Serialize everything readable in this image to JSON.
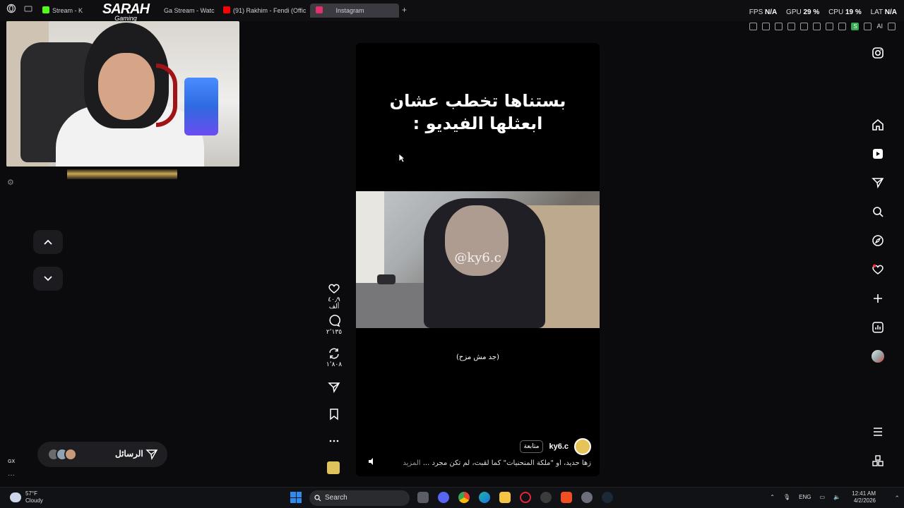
{
  "browser": {
    "tabs": [
      {
        "label": "Stream - K",
        "color": "#53fc18"
      },
      {
        "label": "Ga Stream - Watc",
        "color": "#9146ff"
      },
      {
        "label": "(91) Rakhim - Fendi (Offic",
        "color": "#ff0000"
      },
      {
        "label": "Instagram",
        "color": "#e1306c",
        "active": true
      }
    ],
    "new_tab": "+",
    "stats": {
      "fps_label": "FPS",
      "fps": "N/A",
      "gpu_label": "GPU",
      "gpu": "29 %",
      "cpu_label": "CPU",
      "cpu": "19 %",
      "lat_label": "LAT",
      "lat": "N/A"
    },
    "extension_badge": "S",
    "ai_label": "AI"
  },
  "overlay": {
    "logo_title": "SARAH",
    "logo_subtitle": "Gaming"
  },
  "left": {
    "messages_label": "الرسائل",
    "gx_label": "GX",
    "more": "···"
  },
  "reel": {
    "title_line1": "بستناها تخطب عشان",
    "title_line2": "ابعثلها الفيديو :",
    "watermark": "@ky6.c",
    "subtitle": "(جد مش مزح)",
    "username": "ky6.c",
    "follow_label": "متابعة",
    "description": "زها حديد، أو \"ملكة المنحنيات\" كما لُقبت، لم تكن مجرد ...",
    "more_label": "المزيد"
  },
  "actions": {
    "likes": "٤٠٫٩ ألف",
    "comments": "٢٬١٣٥",
    "reposts": "١٬٨٠٨"
  },
  "sidebar": {
    "icons": [
      "instagram-icon",
      "home-icon",
      "reels-icon",
      "send-icon",
      "search-icon",
      "explore-icon",
      "notifications-icon",
      "create-icon",
      "dashboard-icon",
      "profile-avatar",
      "menu-icon",
      "apps-icon"
    ]
  },
  "taskbar": {
    "temperature": "57°F",
    "condition": "Cloudy",
    "search_placeholder": "Search",
    "language": "ENG",
    "time": "12:41 AM",
    "date": "4/2/2026"
  }
}
